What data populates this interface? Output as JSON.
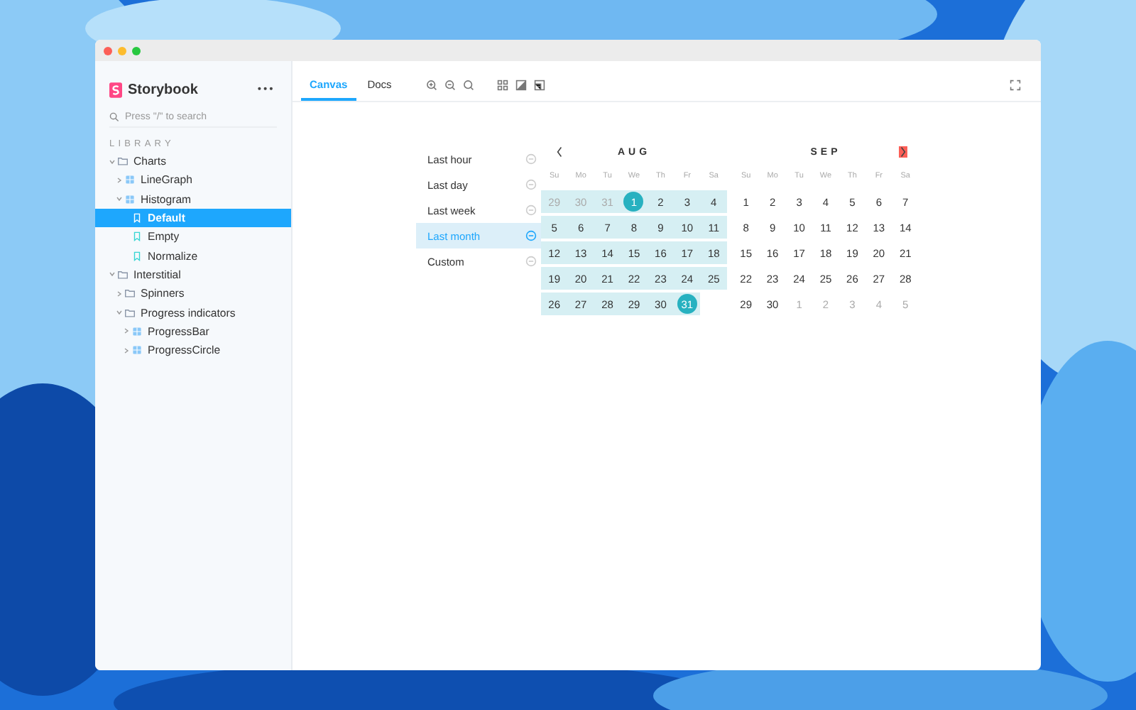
{
  "sidebar": {
    "brand": "Storybook",
    "menu": "•••",
    "search": {
      "placeholder": "Press \"/\" to search"
    },
    "section": "LIBRARY",
    "tree": [
      {
        "label": "Charts",
        "kind": "folder",
        "expanded": true,
        "selected": false,
        "children": [
          {
            "label": "LineGraph",
            "kind": "component",
            "expanded": false,
            "selected": false
          },
          {
            "label": "Histogram",
            "kind": "component",
            "expanded": true,
            "selected": false,
            "children": [
              {
                "label": "Default",
                "kind": "story",
                "selected": true
              },
              {
                "label": "Empty",
                "kind": "story",
                "selected": false
              },
              {
                "label": "Normalize",
                "kind": "story",
                "selected": false
              }
            ]
          }
        ]
      },
      {
        "label": "Interstitial",
        "kind": "folder",
        "expanded": true,
        "selected": false,
        "children": [
          {
            "label": "Spinners",
            "kind": "folder",
            "expanded": false,
            "selected": false
          },
          {
            "label": "Progress indicators",
            "kind": "folder",
            "expanded": true,
            "selected": false,
            "children": [
              {
                "label": "ProgressBar",
                "kind": "component",
                "expanded": false,
                "selected": false
              },
              {
                "label": "ProgressCircle",
                "kind": "component",
                "expanded": false,
                "selected": false
              }
            ]
          }
        ]
      }
    ]
  },
  "toolbar": {
    "tabs": [
      {
        "label": "Canvas",
        "selected": true
      },
      {
        "label": "Docs",
        "selected": false
      }
    ]
  },
  "ranges": [
    {
      "label": "Last hour",
      "selected": false
    },
    {
      "label": "Last day",
      "selected": false
    },
    {
      "label": "Last week",
      "selected": false
    },
    {
      "label": "Last month",
      "selected": true
    },
    {
      "label": "Custom",
      "selected": false
    }
  ],
  "months": [
    {
      "name": "AUG",
      "weekdays": [
        "Su",
        "Mo",
        "Tu",
        "We",
        "Th",
        "Fr",
        "Sa"
      ],
      "weeks": [
        [
          {
            "day": "29",
            "outside": true,
            "in_range": true,
            "endpoint": false
          },
          {
            "day": "30",
            "outside": true,
            "in_range": true,
            "endpoint": false
          },
          {
            "day": "31",
            "outside": true,
            "in_range": true,
            "endpoint": false
          },
          {
            "day": "1",
            "outside": false,
            "in_range": true,
            "endpoint": true
          },
          {
            "day": "2",
            "outside": false,
            "in_range": true,
            "endpoint": false
          },
          {
            "day": "3",
            "outside": false,
            "in_range": true,
            "endpoint": false
          },
          {
            "day": "4",
            "outside": false,
            "in_range": true,
            "endpoint": false
          }
        ],
        [
          {
            "day": "5",
            "outside": false,
            "in_range": true,
            "endpoint": false
          },
          {
            "day": "6",
            "outside": false,
            "in_range": true,
            "endpoint": false
          },
          {
            "day": "7",
            "outside": false,
            "in_range": true,
            "endpoint": false
          },
          {
            "day": "8",
            "outside": false,
            "in_range": true,
            "endpoint": false
          },
          {
            "day": "9",
            "outside": false,
            "in_range": true,
            "endpoint": false
          },
          {
            "day": "10",
            "outside": false,
            "in_range": true,
            "endpoint": false
          },
          {
            "day": "11",
            "outside": false,
            "in_range": true,
            "endpoint": false
          }
        ],
        [
          {
            "day": "12",
            "outside": false,
            "in_range": true,
            "endpoint": false
          },
          {
            "day": "13",
            "outside": false,
            "in_range": true,
            "endpoint": false
          },
          {
            "day": "14",
            "outside": false,
            "in_range": true,
            "endpoint": false
          },
          {
            "day": "15",
            "outside": false,
            "in_range": true,
            "endpoint": false
          },
          {
            "day": "16",
            "outside": false,
            "in_range": true,
            "endpoint": false
          },
          {
            "day": "17",
            "outside": false,
            "in_range": true,
            "endpoint": false
          },
          {
            "day": "18",
            "outside": false,
            "in_range": true,
            "endpoint": false
          }
        ],
        [
          {
            "day": "19",
            "outside": false,
            "in_range": true,
            "endpoint": false
          },
          {
            "day": "20",
            "outside": false,
            "in_range": true,
            "endpoint": false
          },
          {
            "day": "21",
            "outside": false,
            "in_range": true,
            "endpoint": false
          },
          {
            "day": "22",
            "outside": false,
            "in_range": true,
            "endpoint": false
          },
          {
            "day": "23",
            "outside": false,
            "in_range": true,
            "endpoint": false
          },
          {
            "day": "24",
            "outside": false,
            "in_range": true,
            "endpoint": false
          },
          {
            "day": "25",
            "outside": false,
            "in_range": true,
            "endpoint": false
          }
        ],
        [
          {
            "day": "26",
            "outside": false,
            "in_range": true,
            "endpoint": false
          },
          {
            "day": "27",
            "outside": false,
            "in_range": true,
            "endpoint": false
          },
          {
            "day": "28",
            "outside": false,
            "in_range": true,
            "endpoint": false
          },
          {
            "day": "29",
            "outside": false,
            "in_range": true,
            "endpoint": false
          },
          {
            "day": "30",
            "outside": false,
            "in_range": true,
            "endpoint": false
          },
          {
            "day": "31",
            "outside": false,
            "in_range": true,
            "endpoint": true
          }
        ]
      ]
    },
    {
      "name": "SEP",
      "weekdays": [
        "Su",
        "Mo",
        "Tu",
        "We",
        "Th",
        "Fr",
        "Sa"
      ],
      "weeks": [
        [
          {
            "day": "1",
            "outside": false,
            "in_range": false,
            "endpoint": false
          },
          {
            "day": "2",
            "outside": false,
            "in_range": false,
            "endpoint": false
          },
          {
            "day": "3",
            "outside": false,
            "in_range": false,
            "endpoint": false
          },
          {
            "day": "4",
            "outside": false,
            "in_range": false,
            "endpoint": false
          },
          {
            "day": "5",
            "outside": false,
            "in_range": false,
            "endpoint": false
          },
          {
            "day": "6",
            "outside": false,
            "in_range": false,
            "endpoint": false
          },
          {
            "day": "7",
            "outside": false,
            "in_range": false,
            "endpoint": false
          }
        ],
        [
          {
            "day": "8",
            "outside": false,
            "in_range": false,
            "endpoint": false
          },
          {
            "day": "9",
            "outside": false,
            "in_range": false,
            "endpoint": false
          },
          {
            "day": "10",
            "outside": false,
            "in_range": false,
            "endpoint": false
          },
          {
            "day": "11",
            "outside": false,
            "in_range": false,
            "endpoint": false
          },
          {
            "day": "12",
            "outside": false,
            "in_range": false,
            "endpoint": false
          },
          {
            "day": "13",
            "outside": false,
            "in_range": false,
            "endpoint": false
          },
          {
            "day": "14",
            "outside": false,
            "in_range": false,
            "endpoint": false
          }
        ],
        [
          {
            "day": "15",
            "outside": false,
            "in_range": false,
            "endpoint": false
          },
          {
            "day": "16",
            "outside": false,
            "in_range": false,
            "endpoint": false
          },
          {
            "day": "17",
            "outside": false,
            "in_range": false,
            "endpoint": false
          },
          {
            "day": "18",
            "outside": false,
            "in_range": false,
            "endpoint": false
          },
          {
            "day": "19",
            "outside": false,
            "in_range": false,
            "endpoint": false
          },
          {
            "day": "20",
            "outside": false,
            "in_range": false,
            "endpoint": false
          },
          {
            "day": "21",
            "outside": false,
            "in_range": false,
            "endpoint": false
          }
        ],
        [
          {
            "day": "22",
            "outside": false,
            "in_range": false,
            "endpoint": false
          },
          {
            "day": "23",
            "outside": false,
            "in_range": false,
            "endpoint": false
          },
          {
            "day": "24",
            "outside": false,
            "in_range": false,
            "endpoint": false
          },
          {
            "day": "25",
            "outside": false,
            "in_range": false,
            "endpoint": false
          },
          {
            "day": "26",
            "outside": false,
            "in_range": false,
            "endpoint": false
          },
          {
            "day": "27",
            "outside": false,
            "in_range": false,
            "endpoint": false
          },
          {
            "day": "28",
            "outside": false,
            "in_range": false,
            "endpoint": false
          }
        ],
        [
          {
            "day": "29",
            "outside": false,
            "in_range": false,
            "endpoint": false
          },
          {
            "day": "30",
            "outside": false,
            "in_range": false,
            "endpoint": false
          },
          {
            "day": "1",
            "outside": true,
            "in_range": false,
            "endpoint": false
          },
          {
            "day": "2",
            "outside": true,
            "in_range": false,
            "endpoint": false
          },
          {
            "day": "3",
            "outside": true,
            "in_range": false,
            "endpoint": false
          },
          {
            "day": "4",
            "outside": true,
            "in_range": false,
            "endpoint": false
          },
          {
            "day": "5",
            "outside": true,
            "in_range": false,
            "endpoint": false
          }
        ]
      ]
    }
  ]
}
